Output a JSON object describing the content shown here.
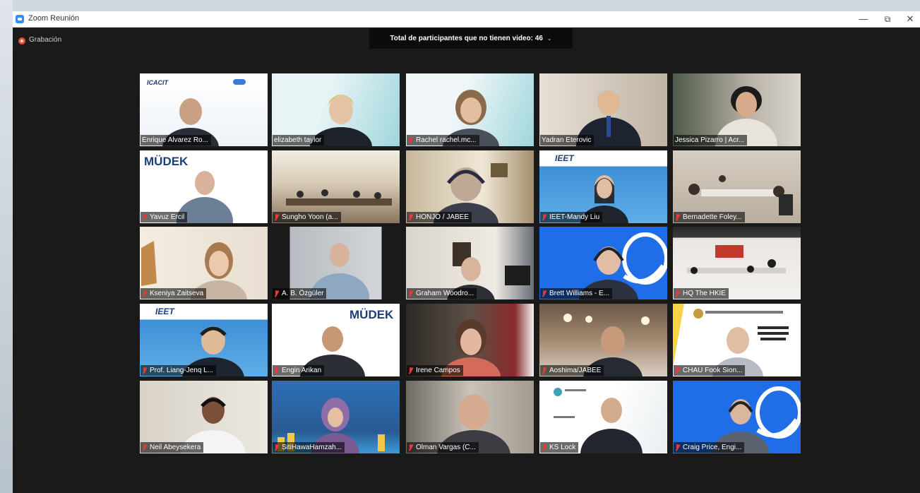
{
  "window": {
    "title": "Zoom Reunión",
    "minimize": "—",
    "maximize": "⧉",
    "close": "✕"
  },
  "recording": {
    "label": "Grabación"
  },
  "banner": {
    "text": "Total de participantes que no tienen video: 46",
    "chevron": "⌄"
  },
  "tiles": [
    {
      "name": "Enrique Alvarez Ro...",
      "logo": "ICACIT",
      "muted": false
    },
    {
      "name": "elizabeth taylor",
      "active": true,
      "muted": false
    },
    {
      "name": "Rachel rachel.mc...",
      "muted": true
    },
    {
      "name": "Yadran Eterovic",
      "muted": false
    },
    {
      "name": "Jessica Pizarro | Acr...",
      "muted": false
    },
    {
      "name": "Yavuz Ercil",
      "logo": "MÜDEK",
      "muted": true
    },
    {
      "name": "Sungho Yoon (a...",
      "muted": true
    },
    {
      "name": "HONJO / JABEE",
      "muted": true
    },
    {
      "name": "IEET-Mandy Liu",
      "logo": "IEET",
      "muted": true
    },
    {
      "name": "Bernadette Foley...",
      "muted": true
    },
    {
      "name": "Kseniya Zaitseva",
      "muted": true
    },
    {
      "name": "A. B. Özgüler",
      "muted": true
    },
    {
      "name": "Graham Woodro...",
      "muted": true
    },
    {
      "name": "Brett Williams - E...",
      "muted": true
    },
    {
      "name": "HQ The HKIE",
      "muted": true
    },
    {
      "name": "Prof. Liang-Jenq L...",
      "logo": "IEET",
      "muted": true
    },
    {
      "name": "Engin Arikan",
      "logo": "MÜDEK",
      "muted": true
    },
    {
      "name": "Irene Campos",
      "muted": true
    },
    {
      "name": "Aoshima/JABEE",
      "muted": true
    },
    {
      "name": "CHAU Fook Sion...",
      "muted": true
    },
    {
      "name": "Neil Abeysekera",
      "muted": true
    },
    {
      "name": "SitiHawaHamzah...",
      "muted": true
    },
    {
      "name": "Olman Vargas (C...",
      "muted": true
    },
    {
      "name": "KS Lock",
      "muted": true
    },
    {
      "name": "Craig Price, Engi...",
      "muted": true
    }
  ],
  "colors": {
    "window_bg": "#1a1a1a",
    "active_outline": "#b6d84a",
    "mute_red": "#e53b3b",
    "zoom_blue": "#2d8cff"
  }
}
